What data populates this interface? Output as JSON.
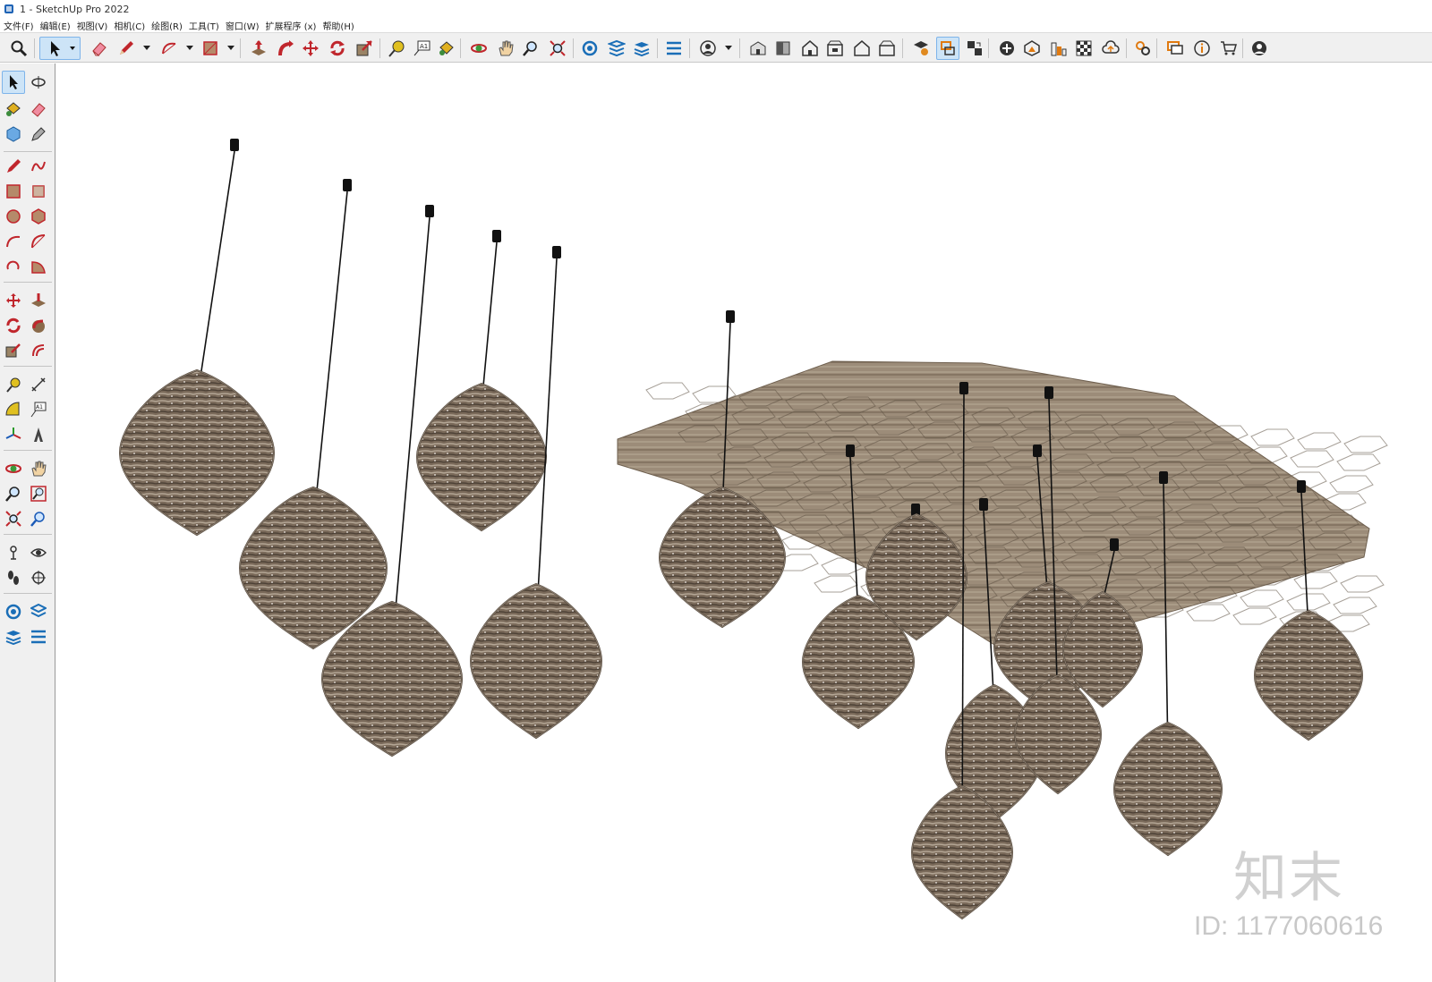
{
  "window": {
    "title": "1 - SketchUp Pro 2022"
  },
  "menu": {
    "items": [
      {
        "label": "文件(F)"
      },
      {
        "label": "编辑(E)"
      },
      {
        "label": "视图(V)"
      },
      {
        "label": "相机(C)"
      },
      {
        "label": "绘图(R)"
      },
      {
        "label": "工具(T)"
      },
      {
        "label": "窗口(W)"
      },
      {
        "label": "扩展程序 (x)"
      },
      {
        "label": "帮助(H)"
      }
    ]
  },
  "toolbar": {
    "tools": [
      {
        "name": "zoom-icon"
      },
      {
        "name": "select-arrow-icon",
        "active": true
      },
      {
        "name": "eraser-icon"
      },
      {
        "name": "pencil-icon"
      },
      {
        "name": "arc-icon"
      },
      {
        "name": "rectangle-icon"
      },
      {
        "name": "push-pull-icon"
      },
      {
        "name": "follow-me-icon"
      },
      {
        "name": "move-icon"
      },
      {
        "name": "rotate-icon"
      },
      {
        "name": "scale-icon"
      },
      {
        "name": "tape-measure-icon"
      },
      {
        "name": "text-icon"
      },
      {
        "name": "paint-bucket-icon"
      },
      {
        "name": "orbit-icon"
      },
      {
        "name": "pan-icon"
      },
      {
        "name": "zoom-window-icon"
      },
      {
        "name": "zoom-extents-icon"
      },
      {
        "name": "warehouse-icon"
      },
      {
        "name": "share-component-icon"
      },
      {
        "name": "extension-warehouse-icon"
      },
      {
        "name": "layout-icon"
      },
      {
        "name": "account-icon"
      },
      {
        "name": "iso-view-icon"
      },
      {
        "name": "top-view-icon"
      },
      {
        "name": "front-view-icon"
      },
      {
        "name": "right-view-icon"
      },
      {
        "name": "back-view-icon"
      },
      {
        "name": "left-view-icon"
      },
      {
        "name": "styles-icon"
      },
      {
        "name": "section-plane-icon"
      },
      {
        "name": "section-display-icon"
      },
      {
        "name": "add-location-icon"
      },
      {
        "name": "terrain-icon"
      },
      {
        "name": "sandbox-icon"
      },
      {
        "name": "checker-icon"
      },
      {
        "name": "cloud-icon"
      },
      {
        "name": "settings-icon"
      },
      {
        "name": "message-icon"
      },
      {
        "name": "info-icon"
      },
      {
        "name": "cart-icon"
      },
      {
        "name": "profile-icon"
      }
    ]
  },
  "watermark": {
    "logo_text": "知末",
    "id_text": "ID: 1177060616"
  },
  "scene": {
    "lamp_color": "#7a6a5a",
    "lamp_dark": "#4d4136",
    "lamp_light": "#b3a594",
    "panel_color": "#9c8c79",
    "cord_color": "#111111"
  }
}
